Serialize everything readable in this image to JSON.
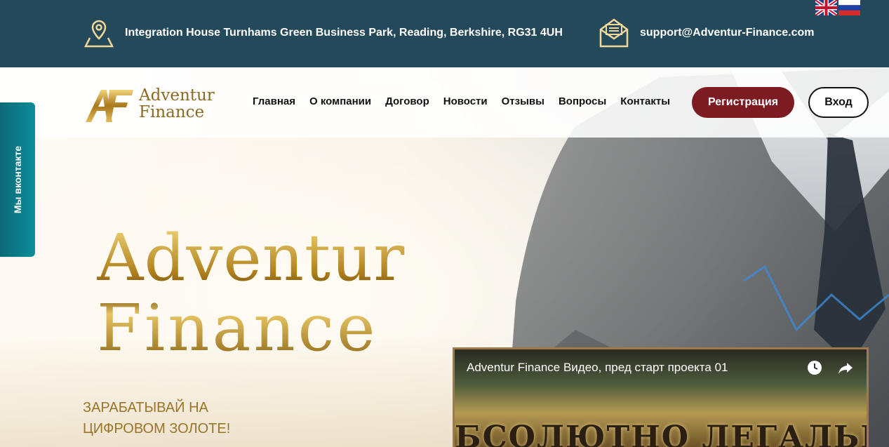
{
  "topbar": {
    "address": "Integration House Turnhams Green Business Park, Reading, Berkshire, RG31 4UH",
    "email": "support@Adventur-Finance.com",
    "address_icon": "map-pin-icon",
    "email_icon": "envelope-icon",
    "languages": [
      "en",
      "ru"
    ]
  },
  "logo": {
    "mark": "AF",
    "line1": "Adventur",
    "line2": "Finance"
  },
  "nav": {
    "items": [
      {
        "label": "Главная"
      },
      {
        "label": "О компании"
      },
      {
        "label": "Договор"
      },
      {
        "label": "Новости"
      },
      {
        "label": "Отзывы"
      },
      {
        "label": "Вопросы"
      },
      {
        "label": "Контакты"
      }
    ],
    "register_label": "Регистрация",
    "login_label": "Вход"
  },
  "side_tab": {
    "label": "Мы вконтакте"
  },
  "hero": {
    "title_line1": "Adventur",
    "title_line2": "Finance",
    "slogan_line1": "ЗАРАБАТЫВАЙ НА",
    "slogan_line2": "ЦИФРОВОМ ЗОЛОТЕ!"
  },
  "video": {
    "title": "Adventur Finance Видео, пред старт проекта 01",
    "frame_text": "БСОЛЮТНО ЛЕГАЛЬНЫЙ БИЗ",
    "icons": [
      "watch-later-icon",
      "share-icon"
    ]
  },
  "colors": {
    "topbar": "#24495a",
    "accent": "#7d1b22",
    "gold": "#9a7526",
    "vk_tab": "#0d8d9a"
  }
}
